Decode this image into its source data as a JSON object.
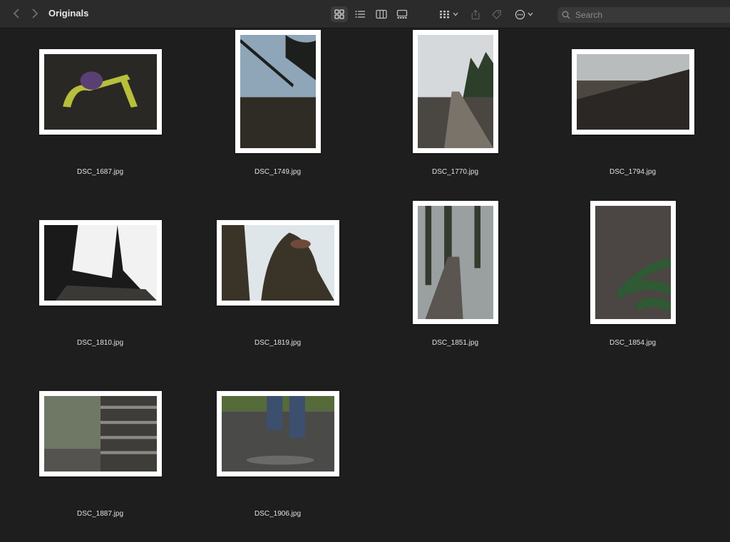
{
  "window": {
    "title": "Originals"
  },
  "toolbar": {
    "back_icon": "chevron-left-icon",
    "forward_icon": "chevron-right-icon",
    "view_modes": [
      "icon-view-icon",
      "list-view-icon",
      "column-view-icon",
      "gallery-view-icon"
    ],
    "active_view": "icon-view-icon",
    "group_icon": "group-by-icon",
    "share_icon": "share-icon",
    "tag_icon": "tag-icon",
    "more_icon": "ellipsis-circle-icon"
  },
  "search": {
    "placeholder": "Search"
  },
  "files": [
    {
      "name": "DSC_1687.jpg",
      "orientation": "landscape",
      "palette": [
        "#2a2824",
        "#b7bf3c",
        "#5a3f74"
      ]
    },
    {
      "name": "DSC_1749.jpg",
      "orientation": "portrait",
      "palette": [
        "#8fa6b8",
        "#1d1f1c",
        "#2f2c25"
      ]
    },
    {
      "name": "DSC_1770.jpg",
      "orientation": "portrait",
      "palette": [
        "#d6d9dc",
        "#7a736a",
        "#2d3f2a"
      ]
    },
    {
      "name": "DSC_1794.jpg",
      "orientation": "landscape",
      "palette": [
        "#b9bcbd",
        "#4c4740",
        "#2a2724"
      ]
    },
    {
      "name": "DSC_1810.jpg",
      "orientation": "landscape",
      "palette": [
        "#f2f2f2",
        "#1a1a1a",
        "#3b3935"
      ]
    },
    {
      "name": "DSC_1819.jpg",
      "orientation": "landscape",
      "palette": [
        "#dfe6ea",
        "#3a3428",
        "#6f4a3a"
      ]
    },
    {
      "name": "DSC_1851.jpg",
      "orientation": "portrait",
      "palette": [
        "#9aa0a0",
        "#343a2e",
        "#5a5550"
      ]
    },
    {
      "name": "DSC_1854.jpg",
      "orientation": "portrait",
      "palette": [
        "#4b4543",
        "#2f5a33",
        "#6d655f"
      ]
    },
    {
      "name": "DSC_1887.jpg",
      "orientation": "landscape",
      "palette": [
        "#6e7864",
        "#8a8a85",
        "#3e3d3a"
      ]
    },
    {
      "name": "DSC_1906.jpg",
      "orientation": "landscape",
      "palette": [
        "#4a4a48",
        "#3c4f6f",
        "#556b3a"
      ]
    }
  ],
  "colors": {
    "background": "#1f1e1e",
    "toolbar": "#2c2b2b",
    "thumbnail_border": "#ffffff"
  }
}
